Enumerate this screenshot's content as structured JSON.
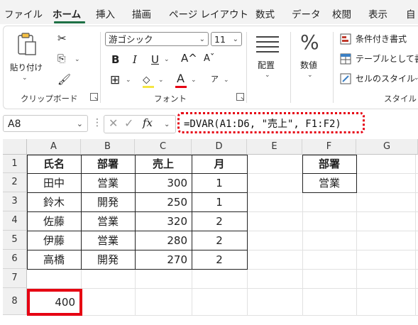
{
  "menu": {
    "tabs": [
      "ファイル",
      "ホーム",
      "挿入",
      "描画",
      "ページ レイアウト",
      "数式",
      "データ",
      "校閲",
      "表示",
      "自"
    ],
    "active_tab": "ホーム"
  },
  "ribbon": {
    "clipboard": {
      "paste_label": "貼り付け",
      "group_label": "クリップボード"
    },
    "font": {
      "font_name": "游ゴシック",
      "font_size": "11",
      "bold": "B",
      "italic": "I",
      "underline": "U",
      "grow": "A^",
      "shrink": "Aˇ",
      "color_a": "A",
      "group_label": "フォント"
    },
    "alignment": {
      "label": "配置"
    },
    "number": {
      "label": "数値",
      "symbol": "%"
    },
    "styles": {
      "conditional": "条件付き書式",
      "table": "テーブルとして書",
      "cell": "セルのスタイル",
      "group_label": "スタイル"
    }
  },
  "formula_bar": {
    "name_box": "A8",
    "fx": "fx",
    "formula": "=DVAR(A1:D6, \"売上\", F1:F2)"
  },
  "sheet": {
    "columns": [
      "A",
      "B",
      "C",
      "D",
      "E",
      "F",
      "G"
    ],
    "rows": [
      "1",
      "2",
      "3",
      "4",
      "5",
      "6",
      "7",
      "8"
    ],
    "table_headers": [
      "氏名",
      "部署",
      "売上",
      "月"
    ],
    "table_rows": [
      [
        "田中",
        "営業",
        "300",
        "1"
      ],
      [
        "鈴木",
        "開発",
        "250",
        "1"
      ],
      [
        "佐藤",
        "営業",
        "320",
        "2"
      ],
      [
        "伊藤",
        "営業",
        "280",
        "2"
      ],
      [
        "高橋",
        "開発",
        "270",
        "2"
      ]
    ],
    "criteria_header": "部署",
    "criteria_value": "営業",
    "result_cell": "400"
  },
  "colors": {
    "accent": "#1e7145",
    "highlight": "#e60012"
  }
}
